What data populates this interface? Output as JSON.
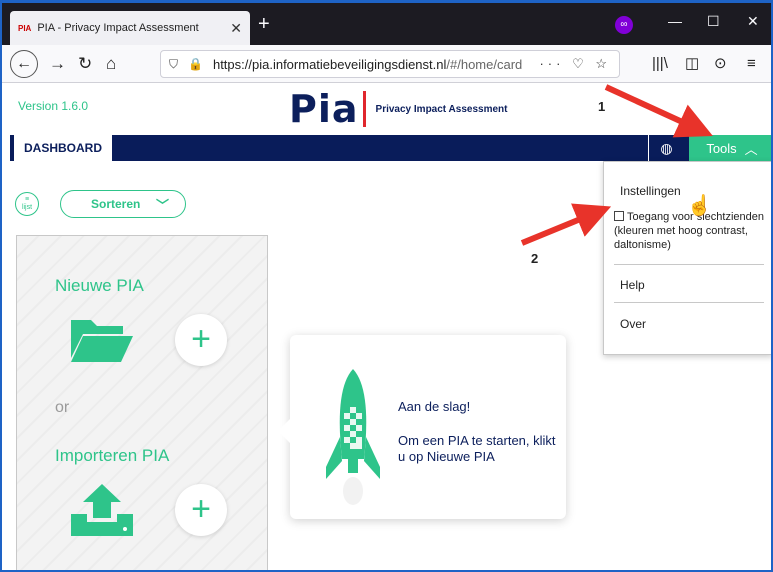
{
  "browser": {
    "tab_title": "PIA - Privacy Impact Assessment",
    "tab_favicon": "PIA",
    "url_host": "https://pia.informatiebeveiligingsdienst.nl",
    "url_path": "/#/home/card",
    "url_actions": "··· ☐ ☆"
  },
  "app": {
    "version": "Version 1.6.0",
    "logo_text": "Pia",
    "logo_subtitle": "Privacy Impact Assessment",
    "nav_dashboard": "DASHBOARD",
    "tools_label": "Tools",
    "accent_color": "#2ec48a",
    "navy_color": "#091c5a"
  },
  "tools_menu": {
    "items": [
      "Instellingen",
      "Help",
      "Over"
    ],
    "accessibility_label": "Toegang voor slechtzienden (kleuren met hoog contrast, daltonisme)"
  },
  "controls": {
    "list_label": "lijst",
    "sort_label": "Sorteren"
  },
  "card": {
    "new_pia": "Nieuwe PIA",
    "or": "or",
    "import_pia": "Importeren PIA"
  },
  "tooltip": {
    "title": "Aan de slag!",
    "text": "Om een PIA te starten, klikt u op Nieuwe PIA"
  },
  "annotations": [
    "1",
    "2"
  ]
}
